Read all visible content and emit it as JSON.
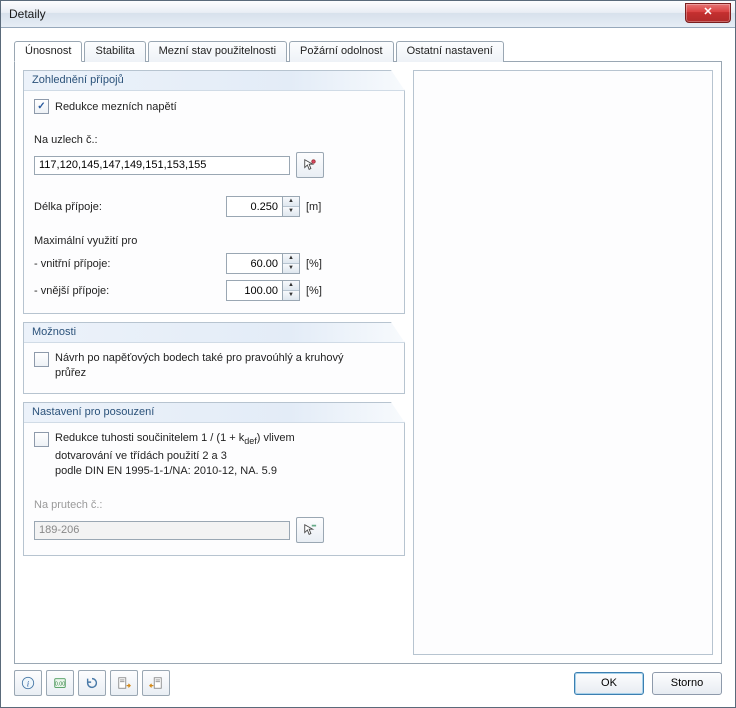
{
  "window": {
    "title": "Detaily"
  },
  "tabs": [
    {
      "label": "Únosnost"
    },
    {
      "label": "Stabilita"
    },
    {
      "label": "Mezní stav použitelnosti"
    },
    {
      "label": "Požární odolnost"
    },
    {
      "label": "Ostatní nastavení"
    }
  ],
  "groups": {
    "connections": {
      "title": "Zohlednění přípojů",
      "reduce_label": "Redukce mezních napětí",
      "reduce_checked": true,
      "nodes_label": "Na uzlech č.:",
      "nodes_value": "117,120,145,147,149,151,153,155",
      "length_label": "Délka přípoje:",
      "length_value": "0.250",
      "length_unit": "[m]",
      "max_util_label": "Maximální využití pro",
      "inner_label": "- vnitřní přípoje:",
      "inner_value": "60.00",
      "inner_unit": "[%]",
      "outer_label": "- vnější přípoje:",
      "outer_value": "100.00",
      "outer_unit": "[%]"
    },
    "options": {
      "title": "Možnosti",
      "stress_points_label": "Návrh po napěťových bodech také pro pravoúhlý a kruhový průřez",
      "stress_points_checked": false
    },
    "assessment": {
      "title": "Nastavení pro posouzení",
      "stiffness_label_1": "Redukce tuhosti součinitelem 1 / (1 + k",
      "stiffness_label_sub": "def",
      "stiffness_label_2": ") vlivem",
      "stiffness_label_3": "dotvarování ve třídách použití 2 a 3",
      "stiffness_label_4": "podle DIN EN 1995-1-1/NA: 2010-12, NA. 5.9",
      "stiffness_checked": false,
      "members_label": "Na prutech č.:",
      "members_value": "189-206"
    }
  },
  "footer": {
    "ok": "OK",
    "cancel": "Storno"
  }
}
